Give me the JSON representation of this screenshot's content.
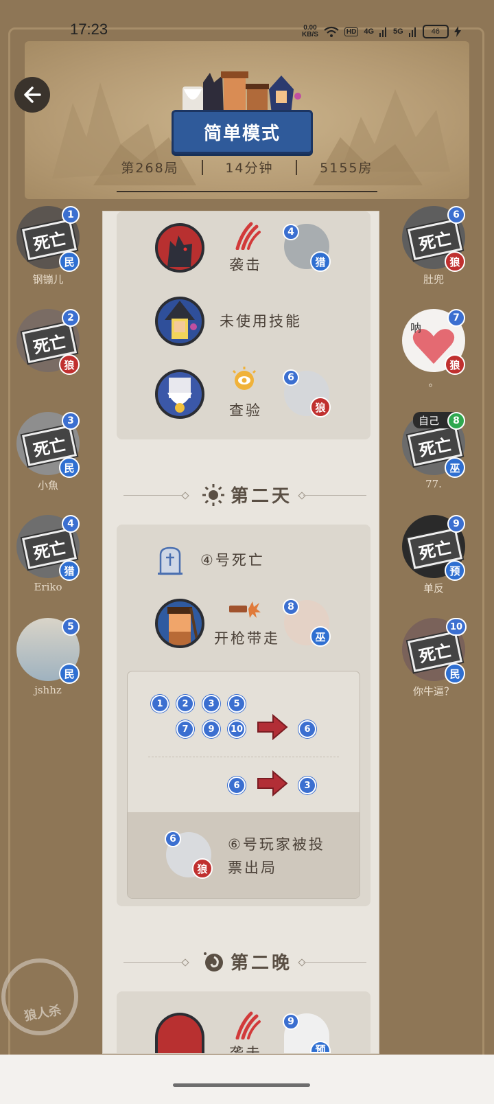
{
  "status_bar": {
    "time": "17:23",
    "net_speed_value": "0.00",
    "net_speed_unit": "KB/S",
    "hd": "HD",
    "sig1": "4G",
    "sig2": "5G",
    "battery": "46"
  },
  "header": {
    "mode_title": "简单模式",
    "round": "第268局",
    "duration": "14分钟",
    "room": "5155房"
  },
  "left_players": [
    {
      "number": "1",
      "name": "钢镚儿",
      "role": "民",
      "dead": true,
      "dead_label": "死亡"
    },
    {
      "number": "2",
      "name": "",
      "role": "狼",
      "dead": true,
      "dead_label": "死亡"
    },
    {
      "number": "3",
      "name": "小魚",
      "role": "民",
      "dead": true,
      "dead_label": "死亡"
    },
    {
      "number": "4",
      "name": "Eriko",
      "role": "猎",
      "dead": true,
      "dead_label": "死亡"
    },
    {
      "number": "5",
      "name": "jshhz",
      "role": "民",
      "dead": false
    }
  ],
  "right_players": [
    {
      "number": "6",
      "name": "肚兜",
      "role": "狼",
      "dead": true,
      "dead_label": "死亡"
    },
    {
      "number": "7",
      "name": "。",
      "role": "狼",
      "dead": false,
      "avatar_text": "呐"
    },
    {
      "number": "8",
      "name": "77.",
      "role": "巫",
      "dead": true,
      "dead_label": "死亡",
      "self_label": "自己"
    },
    {
      "number": "9",
      "name": "单反",
      "role": "预",
      "dead": true,
      "dead_label": "死亡"
    },
    {
      "number": "10",
      "name": "你牛逼？",
      "role": "民",
      "dead": true,
      "dead_label": "死亡"
    }
  ],
  "night1": {
    "wolf_action": "袭击",
    "wolf_target_num": "4",
    "wolf_target_role": "猎",
    "witch_action": "未使用技能",
    "seer_action": "查验",
    "seer_target_num": "6",
    "seer_target_role": "狼"
  },
  "day2": {
    "title": "第二天",
    "death_text": "④号死亡",
    "hunter_action": "开枪带走",
    "hunter_target_num": "8",
    "hunter_target_role": "巫",
    "vote_row1": [
      "1",
      "2",
      "3",
      "5"
    ],
    "vote_row2": [
      "7",
      "9",
      "10"
    ],
    "vote_target1": "6",
    "vote_from2": "6",
    "vote_target2": "3",
    "result_num": "6",
    "result_role": "狼",
    "result_text_line1": "⑥号玩家被投",
    "result_text_line2": "票出局"
  },
  "night2": {
    "title": "第二晚",
    "wolf_action": "袭击",
    "wolf_target_num": "9",
    "wolf_target_role": "预"
  },
  "watermark": "狼人杀",
  "colors": {
    "background": "#8e7656",
    "paper": "#e9e5de",
    "card": "#dcd7ce",
    "badge_blue": "#3b6fd0",
    "badge_red": "#c0302f",
    "vote_arrow": "#b22e36"
  }
}
